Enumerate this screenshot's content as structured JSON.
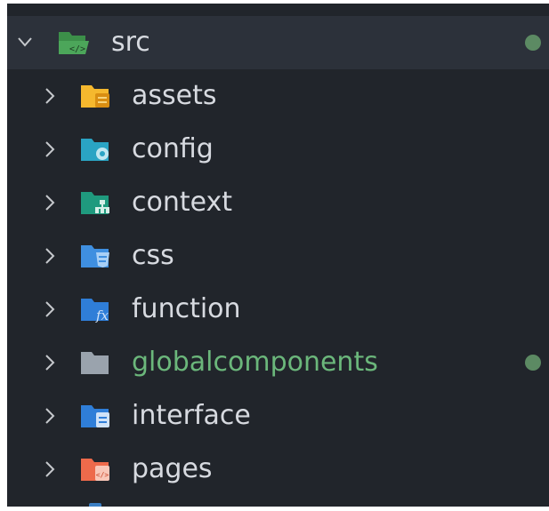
{
  "explorer": {
    "root": {
      "label": "src",
      "expanded": true,
      "icon": "folder-src-open-icon",
      "color": "#4ca65a",
      "status": "modified"
    },
    "items": [
      {
        "label": "assets",
        "icon": "folder-assets-icon",
        "color": "#f5b82e",
        "status": ""
      },
      {
        "label": "config",
        "icon": "folder-config-icon",
        "color": "#2aa4c4",
        "status": ""
      },
      {
        "label": "context",
        "icon": "folder-context-icon",
        "color": "#1f9a7e",
        "status": ""
      },
      {
        "label": "css",
        "icon": "folder-css-icon",
        "color": "#3f8fe0",
        "status": ""
      },
      {
        "label": "function",
        "icon": "folder-function-icon",
        "color": "#2f7ed8",
        "status": ""
      },
      {
        "label": "globalcomponents",
        "icon": "folder-icon",
        "color": "#9aa3ad",
        "status": "modified"
      },
      {
        "label": "interface",
        "icon": "folder-interface-icon",
        "color": "#2f7ed8",
        "status": ""
      },
      {
        "label": "pages",
        "icon": "folder-pages-icon",
        "color": "#ee6a4b",
        "status": ""
      }
    ]
  }
}
